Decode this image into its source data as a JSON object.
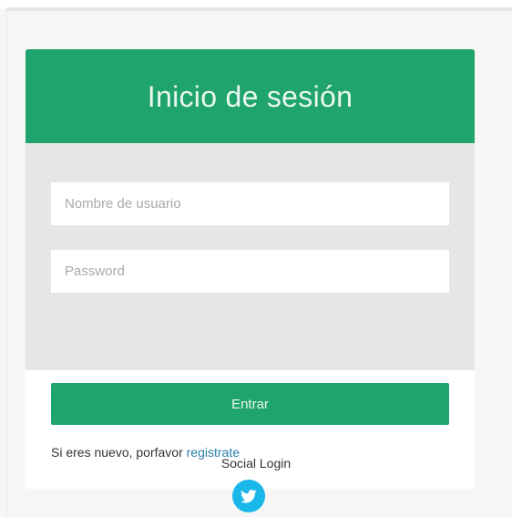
{
  "login": {
    "title": "Inicio de sesión",
    "username_placeholder": "Nombre de usuario",
    "password_placeholder": "Password",
    "submit_label": "Entrar",
    "register_prefix": "Si eres nuevo, porfavor ",
    "register_link": "registrate"
  },
  "social": {
    "label": "Social Login",
    "providers": [
      {
        "name": "twitter",
        "icon": "twitter-icon"
      }
    ]
  },
  "colors": {
    "brand_green": "#1ea46c",
    "twitter_blue": "#19b7ea",
    "link_blue": "#2a7fa6",
    "panel_gray": "#e6e6e6"
  }
}
